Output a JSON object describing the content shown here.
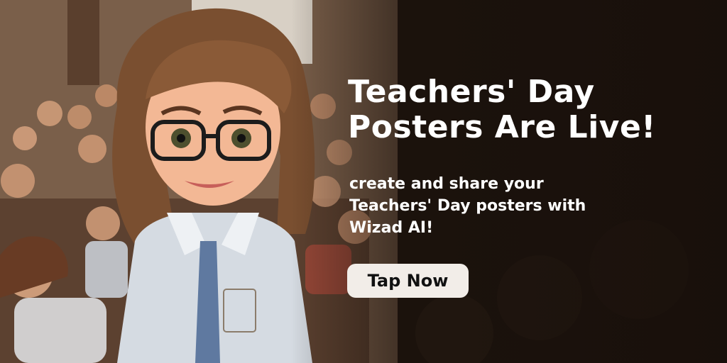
{
  "headline": {
    "line1": "Teachers' Day",
    "line2": "Posters Are Live!"
  },
  "subtext": {
    "line1": "create and share your",
    "line2": "Teachers' Day posters with",
    "line3": "Wizad AI!"
  },
  "cta": {
    "label": "Tap Now"
  },
  "colors": {
    "text": "#ffffff",
    "button_bg": "#f2ede8",
    "button_text": "#111111"
  }
}
